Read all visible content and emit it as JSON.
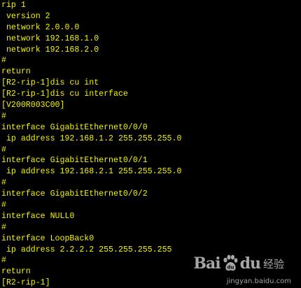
{
  "terminal": {
    "text_color": "#f4f400",
    "background": "#000000",
    "lines": [
      "rip 1",
      " version 2",
      " network 2.0.0.0",
      " network 192.168.1.0",
      " network 192.168.2.0",
      "#",
      "return",
      "[R2-rip-1]dis cu int",
      "[R2-rip-1]dis cu interface",
      "[V200R003C00]",
      "#",
      "interface GigabitEthernet0/0/0",
      " ip address 192.168.1.2 255.255.255.0",
      "#",
      "interface GigabitEthernet0/0/1",
      " ip address 192.168.2.1 255.255.255.0",
      "#",
      "interface GigabitEthernet0/0/2",
      "#",
      "interface NULL0",
      "#",
      "interface LoopBack0",
      " ip address 2.2.2.2 255.255.255.255",
      "#",
      "return",
      "[R2-rip-1]"
    ]
  },
  "watermark": {
    "logo_left": "Bai",
    "logo_icon": "paw-icon",
    "logo_right": "du",
    "logo_cn": "经验",
    "url": "jingyan.baidu.com"
  }
}
